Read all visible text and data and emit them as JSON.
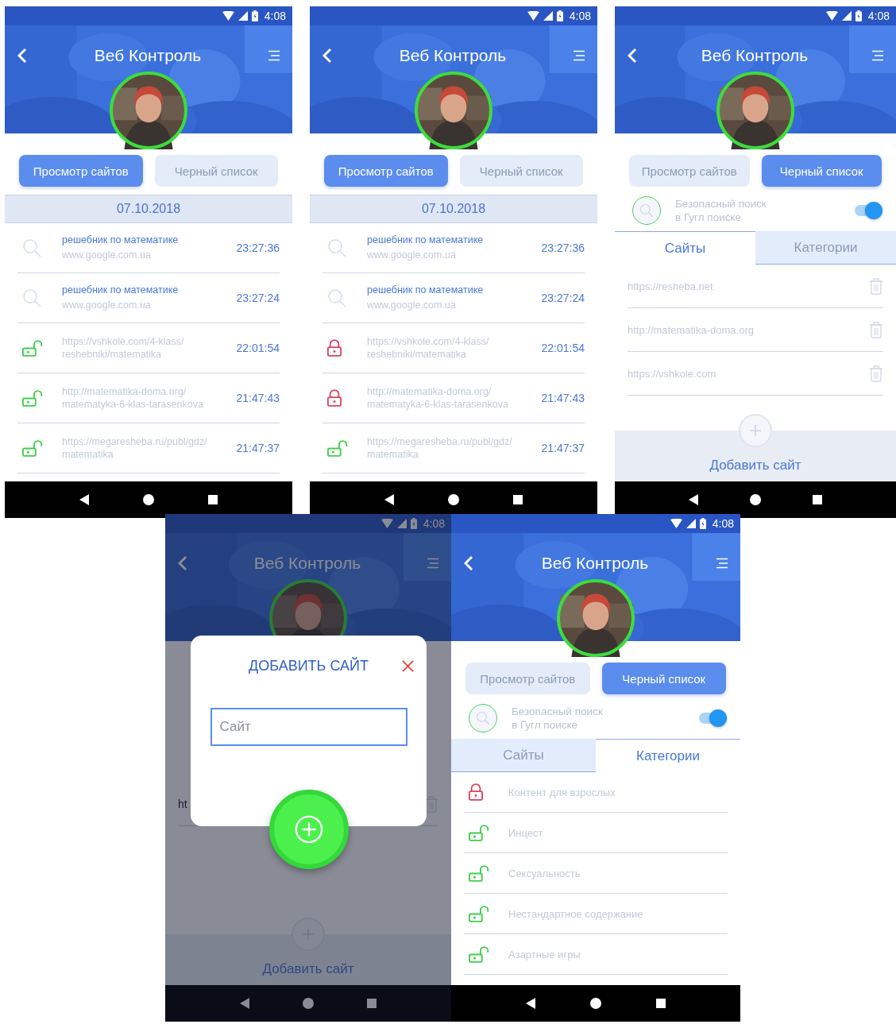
{
  "screens": [
    {
      "kind": "history",
      "time": "4:08",
      "title": "Веб Контроль",
      "tabs": [
        {
          "label": "Просмотр сайтов",
          "selected": true
        },
        {
          "label": "Черный список",
          "selected": false
        }
      ],
      "date": "07.10.2018",
      "entries": [
        {
          "kind": "search",
          "query": "решебник по математике",
          "lines": [
            "www.google.com.ua"
          ],
          "time": "23:27:36"
        },
        {
          "kind": "search",
          "query": "решебник по математике",
          "lines": [
            "www.google.com.ua"
          ],
          "time": "23:27:24"
        },
        {
          "kind": "site",
          "blocked": false,
          "lines": [
            "https://vshkole.com/4-klass/",
            "reshebniki/matematika"
          ],
          "time": "22:01:54"
        },
        {
          "kind": "site",
          "blocked": false,
          "lines": [
            "http://matematika-doma.org/",
            "matematyka-6-klas-tarasenkova"
          ],
          "time": "21:47:43"
        },
        {
          "kind": "site",
          "blocked": false,
          "lines": [
            "https://megaresheba.ru/publ/gdz/",
            "matematika"
          ],
          "time": "21:47:37"
        }
      ]
    },
    {
      "kind": "history",
      "time": "4:08",
      "title": "Веб Контроль",
      "tabs": [
        {
          "label": "Просмотр сайтов",
          "selected": true
        },
        {
          "label": "Черный список",
          "selected": false
        }
      ],
      "date": "07.10.2018",
      "entries": [
        {
          "kind": "search",
          "query": "решебник по математике",
          "lines": [
            "www.google.com.ua"
          ],
          "time": "23:27:36"
        },
        {
          "kind": "search",
          "query": "решебник по математике",
          "lines": [
            "www.google.com.ua"
          ],
          "time": "23:27:24"
        },
        {
          "kind": "site",
          "blocked": true,
          "lines": [
            "https://vshkole.com/4-klass/",
            "reshebniki/matematika"
          ],
          "time": "22:01:54"
        },
        {
          "kind": "site",
          "blocked": true,
          "lines": [
            "http://matematika-doma.org/",
            "matematyka-6-klas-tarasenkova"
          ],
          "time": "21:47:43"
        },
        {
          "kind": "site",
          "blocked": false,
          "lines": [
            "https://megaresheba.ru/publ/gdz/",
            "matematika"
          ],
          "time": "21:47:37"
        }
      ]
    },
    {
      "kind": "blacklist",
      "time": "4:08",
      "title": "Веб Контроль",
      "tabs": [
        {
          "label": "Просмотр сайтов",
          "selected": false
        },
        {
          "label": "Черный список",
          "selected": true
        }
      ],
      "safe_search": {
        "lines": [
          "Безопасный поиск",
          "в Гугл поиске"
        ],
        "on": true
      },
      "subtabs": [
        {
          "label": "Сайты",
          "selected": true
        },
        {
          "label": "Категории",
          "selected": false
        }
      ],
      "sites": [
        "https://resheba.net",
        "http://matematika-doma.org",
        "https://vshkole.com"
      ],
      "add_label": "Добавить сайт"
    },
    {
      "kind": "dialog",
      "time": "4:08",
      "title": "Веб Контроль",
      "sites": [
        "ht"
      ],
      "add_label": "Добавить сайт",
      "dialog": {
        "title": "ДОБАВИТЬ САЙТ",
        "placeholder": "Сайт"
      }
    },
    {
      "kind": "blacklist",
      "time": "4:08",
      "title": "Веб Контроль",
      "tabs": [
        {
          "label": "Просмотр сайтов",
          "selected": false
        },
        {
          "label": "Черный список",
          "selected": true
        }
      ],
      "safe_search": {
        "lines": [
          "Безопасный поиск",
          "в Гугл поиске"
        ],
        "on": true
      },
      "subtabs": [
        {
          "label": "Сайты",
          "selected": false
        },
        {
          "label": "Категории",
          "selected": true
        }
      ],
      "categories": [
        {
          "label": "Контент для взрослых",
          "blocked": true
        },
        {
          "label": "Инцест",
          "blocked": false
        },
        {
          "label": "Сексуальность",
          "blocked": false
        },
        {
          "label": "Нестандартное содержание",
          "blocked": false
        },
        {
          "label": "Азартные игры",
          "blocked": false
        }
      ]
    }
  ]
}
